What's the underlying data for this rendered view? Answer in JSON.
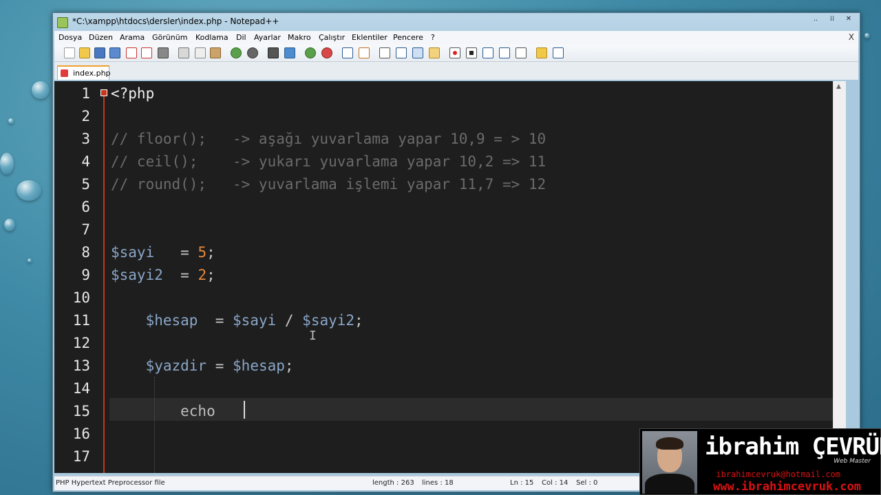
{
  "window": {
    "title": "*C:\\xampp\\htdocs\\dersler\\index.php - Notepad++",
    "minimize": "..",
    "maximize": "⁞⁞",
    "close": "✕"
  },
  "menu": {
    "items": [
      "Dosya",
      "Düzen",
      "Arama",
      "Görünüm",
      "Kodlama",
      "Dil",
      "Ayarlar",
      "Makro",
      "Çalıştır",
      "Eklentiler",
      "Pencere",
      "?"
    ],
    "close_label": "X"
  },
  "toolbar": {
    "icons": [
      "new-file-icon",
      "open-file-icon",
      "save-icon",
      "save-all-icon",
      "close-icon",
      "close-all-icon",
      "print-icon",
      "cut-icon",
      "copy-icon",
      "paste-icon",
      "undo-icon",
      "redo-icon",
      "find-icon",
      "replace-icon",
      "zoom-in-icon",
      "zoom-out-icon",
      "sync-vertical-icon",
      "sync-horizontal-icon",
      "word-wrap-icon",
      "show-all-chars-icon",
      "indent-guide-icon",
      "user-lang-icon",
      "record-macro-icon",
      "stop-macro-icon",
      "play-macro-icon",
      "run-macro-multiple-icon",
      "save-macro-icon",
      "launch-browser-icon",
      "spellcheck-icon"
    ]
  },
  "tabs": [
    {
      "label": "index.php",
      "modified": true
    }
  ],
  "editor": {
    "line_numbers": [
      "1",
      "2",
      "3",
      "4",
      "5",
      "6",
      "7",
      "8",
      "9",
      "10",
      "11",
      "12",
      "13",
      "14",
      "15",
      "16",
      "17"
    ],
    "lines": [
      [
        {
          "t": "<?php",
          "c": "t-php"
        }
      ],
      [],
      [
        {
          "t": "// floor();   -> aşağı yuvarlama yapar 10,9 = > 10",
          "c": "t-cm"
        }
      ],
      [
        {
          "t": "// ceil();    -> yukarı yuvarlama yapar 10,2 => 11",
          "c": "t-cm"
        }
      ],
      [
        {
          "t": "// round();   -> yuvarlama işlemi yapar 11,7 => 12",
          "c": "t-cm"
        }
      ],
      [],
      [],
      [
        {
          "t": "$sayi",
          "c": "t-var"
        },
        {
          "t": "   = ",
          "c": "t-op"
        },
        {
          "t": "5",
          "c": "t-num"
        },
        {
          "t": ";",
          "c": "t-op"
        }
      ],
      [
        {
          "t": "$sayi2",
          "c": "t-var"
        },
        {
          "t": "  = ",
          "c": "t-op"
        },
        {
          "t": "2",
          "c": "t-num"
        },
        {
          "t": ";",
          "c": "t-op"
        }
      ],
      [],
      [
        {
          "t": "    ",
          "c": "t-op"
        },
        {
          "t": "$hesap",
          "c": "t-var"
        },
        {
          "t": "  = ",
          "c": "t-op"
        },
        {
          "t": "$sayi",
          "c": "t-var"
        },
        {
          "t": " / ",
          "c": "t-op"
        },
        {
          "t": "$sayi2",
          "c": "t-var"
        },
        {
          "t": ";",
          "c": "t-op"
        }
      ],
      [],
      [
        {
          "t": "    ",
          "c": "t-op"
        },
        {
          "t": "$yazdir",
          "c": "t-var"
        },
        {
          "t": " = ",
          "c": "t-op"
        },
        {
          "t": "$hesap",
          "c": "t-var"
        },
        {
          "t": ";",
          "c": "t-op"
        }
      ],
      [],
      [
        {
          "t": "        echo ",
          "c": "t-kw"
        }
      ],
      [],
      []
    ]
  },
  "status": {
    "file_type": "PHP Hypertext Preprocessor file",
    "length": "length : 263",
    "lines": "lines : 18",
    "ln": "Ln : 15",
    "col": "Col : 14",
    "sel": "Sel : 0"
  },
  "watermark": {
    "name": "ibrahim ÇEVRÜK",
    "role": "Web Master",
    "email": "ibrahimcevruk@hotmail.com",
    "site": "www.ibrahimcevruk.com"
  }
}
